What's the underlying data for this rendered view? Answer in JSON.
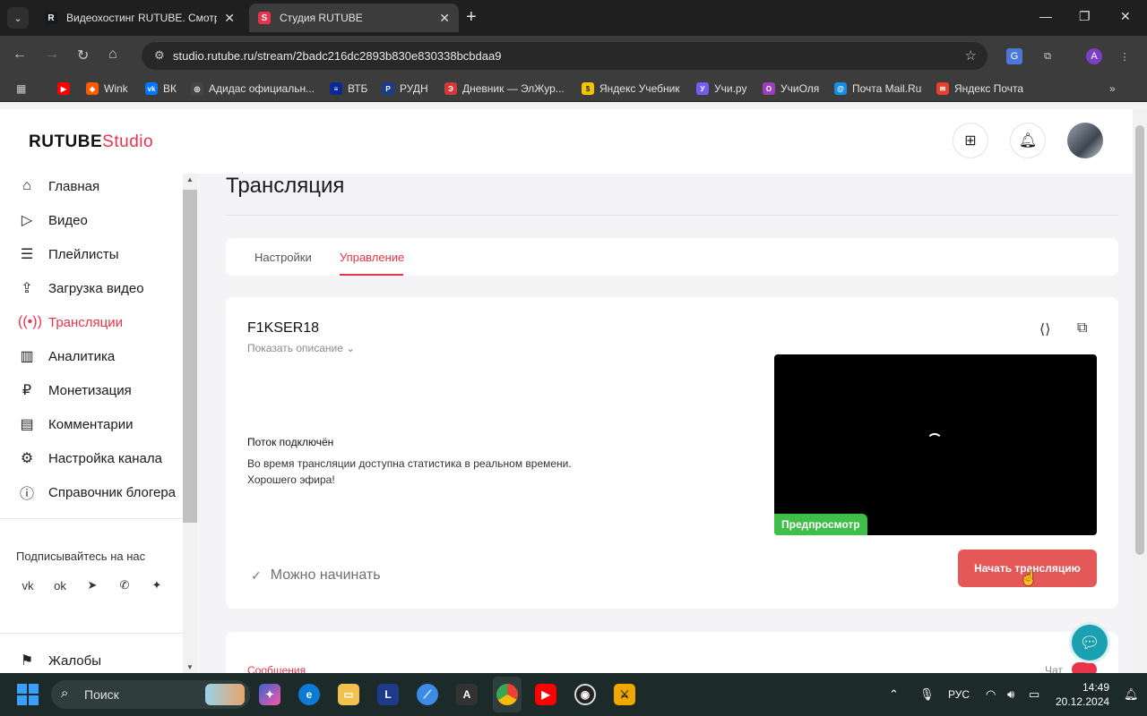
{
  "browser": {
    "tabs": [
      {
        "title": "Видеохостинг RUTUBE. Смотри",
        "favicon": "R",
        "favicon_color": "#14191f",
        "active": false
      },
      {
        "title": "Студия RUTUBE",
        "favicon": "S",
        "favicon_color": "#e8334a",
        "active": true
      }
    ],
    "url": "studio.rutube.ru/stream/2badc216dc2893b830e830338bcbdaa9",
    "profile_initial": "A",
    "bookmarks": [
      {
        "label": "",
        "icon": "youtube-icon",
        "color": "#ff0000"
      },
      {
        "label": "Wink",
        "icon": "wink-icon",
        "color": "#ff5a00"
      },
      {
        "label": "ВК",
        "icon": "vk-icon",
        "color": "#0077ff"
      },
      {
        "label": "Адидас официальн...",
        "icon": "adidas-icon",
        "color": "#444444"
      },
      {
        "label": "ВТБ",
        "icon": "vtb-icon",
        "color": "#0a2896"
      },
      {
        "label": "РУДН",
        "icon": "rudn-icon",
        "color": "#1a3c8c"
      },
      {
        "label": "Дневник — ЭлЖур...",
        "icon": "eljur-icon",
        "color": "#d23a3a"
      },
      {
        "label": "Яндекс Учебник",
        "icon": "yandex-uchebnik-icon",
        "color": "#f5c400"
      },
      {
        "label": "Учи.ру",
        "icon": "uchi-icon",
        "color": "#7a5af5"
      },
      {
        "label": "УчиОля",
        "icon": "uchiolya-icon",
        "color": "#9b3fbf"
      },
      {
        "label": "Почта Mail.Ru",
        "icon": "mailru-icon",
        "color": "#168de2"
      },
      {
        "label": "Яндекс Почта",
        "icon": "yandex-mail-icon",
        "color": "#e8402a"
      }
    ]
  },
  "header": {
    "logo_main": "RUTUBE",
    "logo_sub": "Studio"
  },
  "sidebar": {
    "items": [
      {
        "label": "Главная",
        "icon": "home-icon",
        "active": false
      },
      {
        "label": "Видео",
        "icon": "video-icon",
        "active": false
      },
      {
        "label": "Плейлисты",
        "icon": "playlist-icon",
        "active": false
      },
      {
        "label": "Загрузка видео",
        "icon": "upload-icon",
        "active": false
      },
      {
        "label": "Трансляции",
        "icon": "broadcast-icon",
        "active": true
      },
      {
        "label": "Аналитика",
        "icon": "analytics-icon",
        "active": false
      },
      {
        "label": "Монетизация",
        "icon": "ruble-icon",
        "active": false
      },
      {
        "label": "Комментарии",
        "icon": "comment-icon",
        "active": false
      },
      {
        "label": "Настройка канала",
        "icon": "gear-icon",
        "active": false
      },
      {
        "label": "Справочник блогера",
        "icon": "info-icon",
        "active": false
      }
    ],
    "subscribe_label": "Подписывайтесь на нас",
    "socials": [
      "vk-icon",
      "odnoklassniki-icon",
      "telegram-icon",
      "viber-icon",
      "sparkle-icon"
    ],
    "bottom_item": {
      "label": "Жалобы",
      "icon": "flag-icon"
    }
  },
  "page": {
    "title": "Трансляция",
    "tabs": [
      {
        "label": "Настройки",
        "active": false
      },
      {
        "label": "Управление",
        "active": true
      }
    ]
  },
  "stream": {
    "name": "F1KSER18",
    "show_description": "Показать описание",
    "status_title": "Поток подключён",
    "status_line1": "Во время трансляции доступна статистика в реальном времени.",
    "status_line2": "Хорошего эфира!",
    "preview_badge": "Предпросмотр",
    "ready_label": "Можно начинать",
    "start_button": "Начать трансляцию"
  },
  "chat": {
    "tab_label": "Сообщения",
    "toggle_label": "Чат",
    "toggle_on": true
  },
  "taskbar": {
    "search_label": "Поиск",
    "language": "РУС",
    "time": "14:49",
    "date": "20.12.2024"
  },
  "colors": {
    "accent": "#e8334a",
    "start_button": "#e55858",
    "preview_badge": "#3fbf4a",
    "help_button": "#1aa0b0"
  }
}
